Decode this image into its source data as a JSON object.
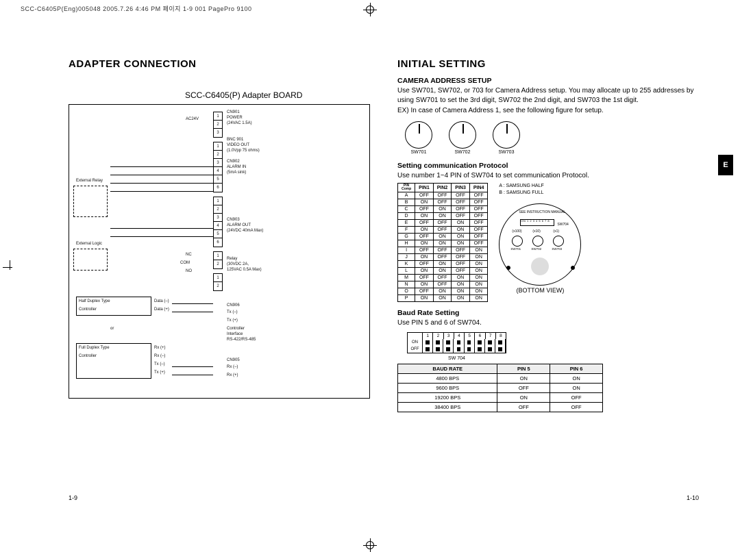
{
  "meta_line": "SCC-C6405P(Eng)005048  2005.7.26 4:46 PM 페이지 1-9  001 PagePro 9100",
  "side_tab": "E",
  "left": {
    "heading": "ADAPTER CONNECTION",
    "board_title": "SCC-C6405(P) Adapter BOARD",
    "page_no": "1-9",
    "schem": {
      "ac24v": "AC24V",
      "cn901": "CN901",
      "power": "POWER",
      "power_spec": "(24VAC 1.5A)",
      "bnc901": "BNC 901",
      "video_out": "VIDEO OUT",
      "video_spec": "(1.0Vpp 75 ohms)",
      "cn902": "CN902",
      "alarm_in": "ALARM  IN",
      "alarm_in_spec": "(5mA sink)",
      "ext_relay": "External   Relay",
      "cn903": "CN903",
      "alarm_out": "ALARM OUT",
      "alarm_out_spec": "(24VDC 40mA Max)",
      "ext_logic": "External         Logic",
      "nc": "NC",
      "com": "COM",
      "no": "NO",
      "relay": "Relay",
      "relay_spec1": "(30VDC 2A,",
      "relay_spec2": "125VAC 0.5A Max)",
      "half_duplex": "Half Duplex Type",
      "controller": "Controller",
      "data_minus": "Data (–)",
      "data_plus": "Data (+)",
      "or": "or",
      "full_duplex": "Full Duplex Type",
      "rx_plus": "Rx (+)",
      "rx_minus": "Rx (–)",
      "tx_minus": "Tx (–)",
      "tx_plus": "Tx (+)",
      "cn906": "CN906",
      "cn905": "CN905",
      "ctrl_if": "Controller",
      "ctrl_if2": "Interface",
      "rs": "RS-422/RS-485"
    }
  },
  "right": {
    "heading": "INITIAL SETTING",
    "page_no": "1-10",
    "cam_addr_h": "CAMERA ADDRESS SETUP",
    "cam_addr_p1": "Use SW701, SW702, or 703 for Camera Address setup. You may allocate up to 255 addresses by using SW701 to set the 3rd digit, SW702 the 2nd digit, and SW703 the 1st digit.",
    "cam_addr_p2": "EX) In case of Camera Address 1, see the following figure for setup.",
    "rotary": [
      "SW701",
      "SW702",
      "SW703"
    ],
    "proto_h": "Setting communication Protocol",
    "proto_p": "Use number 1~4 PIN of SW704 to set communication Protocol.",
    "proto_corner": "PIN\nComp",
    "proto_headers": [
      "PIN1",
      "PIN2",
      "PIN3",
      "PIN4"
    ],
    "proto_rows": [
      {
        "k": "A",
        "v": [
          "OFF",
          "OFF",
          "OFF",
          "OFF"
        ]
      },
      {
        "k": "B",
        "v": [
          "ON",
          "OFF",
          "OFF",
          "OFF"
        ]
      },
      {
        "k": "C",
        "v": [
          "OFF",
          "ON",
          "OFF",
          "OFF"
        ]
      },
      {
        "k": "D",
        "v": [
          "ON",
          "ON",
          "OFF",
          "OFF"
        ]
      },
      {
        "k": "E",
        "v": [
          "OFF",
          "OFF",
          "ON",
          "OFF"
        ]
      },
      {
        "k": "F",
        "v": [
          "ON",
          "OFF",
          "ON",
          "OFF"
        ]
      },
      {
        "k": "G",
        "v": [
          "OFF",
          "ON",
          "ON",
          "OFF"
        ]
      },
      {
        "k": "H",
        "v": [
          "ON",
          "ON",
          "ON",
          "OFF"
        ]
      },
      {
        "k": "I",
        "v": [
          "OFF",
          "OFF",
          "OFF",
          "ON"
        ]
      },
      {
        "k": "J",
        "v": [
          "ON",
          "OFF",
          "OFF",
          "ON"
        ]
      },
      {
        "k": "K",
        "v": [
          "OFF",
          "ON",
          "OFF",
          "ON"
        ]
      },
      {
        "k": "L",
        "v": [
          "ON",
          "ON",
          "OFF",
          "ON"
        ]
      },
      {
        "k": "M",
        "v": [
          "OFF",
          "OFF",
          "ON",
          "ON"
        ]
      },
      {
        "k": "N",
        "v": [
          "ON",
          "OFF",
          "ON",
          "ON"
        ]
      },
      {
        "k": "O",
        "v": [
          "OFF",
          "ON",
          "ON",
          "ON"
        ]
      },
      {
        "k": "P",
        "v": [
          "ON",
          "ON",
          "ON",
          "ON"
        ]
      }
    ],
    "proto_note_a": "A : SAMSUNG HALF",
    "proto_note_b": "B : SAMSUNG FULL",
    "bottom_view": "(BOTTOM VIEW)",
    "bv_inst": "SEE INSTRUCTION MANUAL",
    "bv_sw704": "SW704",
    "bv_dip_nums": "ON 1 2 3 4 5 6 7 8",
    "bv_x100": "(x100)",
    "bv_x10": "(x10)",
    "bv_x1": "(x1)",
    "bv_sw": [
      "SW701",
      "SW702",
      "SW703"
    ],
    "baud_h": "Baud Rate Setting",
    "baud_p": "Use PIN 5 and 6 of SW704.",
    "dip_nums": [
      "1",
      "2",
      "3",
      "4",
      "5",
      "6",
      "7",
      "8"
    ],
    "dip_on": "ON",
    "dip_off": "OFF",
    "dip_label": "SW 704",
    "baud_headers": [
      "BAUD RATE",
      "PIN 5",
      "PIN 6"
    ],
    "baud_rows": [
      [
        "4800 BPS",
        "ON",
        "ON"
      ],
      [
        "9600 BPS",
        "OFF",
        "ON"
      ],
      [
        "19200 BPS",
        "ON",
        "OFF"
      ],
      [
        "38400 BPS",
        "OFF",
        "OFF"
      ]
    ]
  }
}
